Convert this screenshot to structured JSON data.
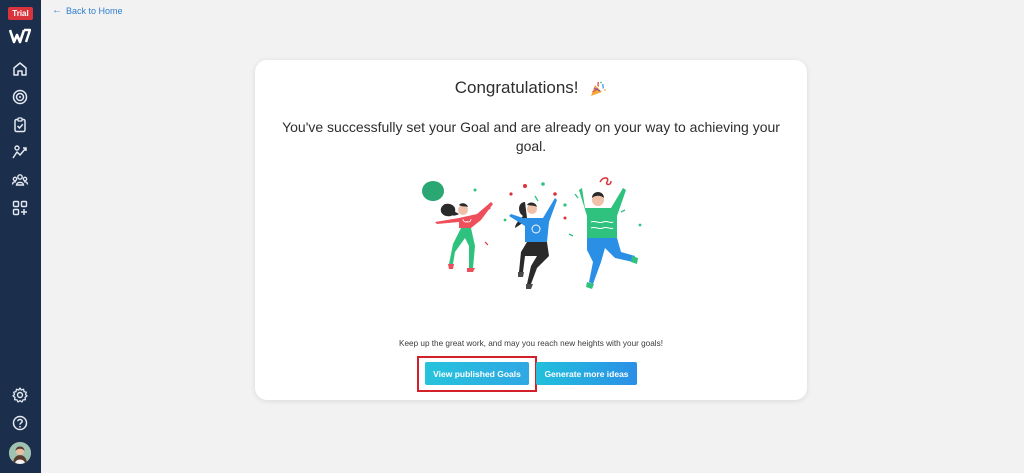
{
  "sidebar": {
    "badge": "Trial",
    "icons": [
      "logo-icon",
      "home-icon",
      "target-icon",
      "clipboard-icon",
      "growth-icon",
      "team-icon",
      "apps-icon",
      "settings-icon",
      "help-icon"
    ]
  },
  "topbar": {
    "back_label": "Back to Home"
  },
  "card": {
    "title": "Congratulations!",
    "subtitle": "You've successfully set your Goal and are already on your way to achieving your goal.",
    "message": "Keep up the great work, and may you reach new heights with your goals!",
    "view_button": "View published Goals",
    "generate_button": "Generate more ideas"
  },
  "colors": {
    "sidebar_bg": "#1b2e4b",
    "badge_red": "#d9343b",
    "accent_blue": "#2f7fd0",
    "highlight_red": "#d4202b"
  }
}
